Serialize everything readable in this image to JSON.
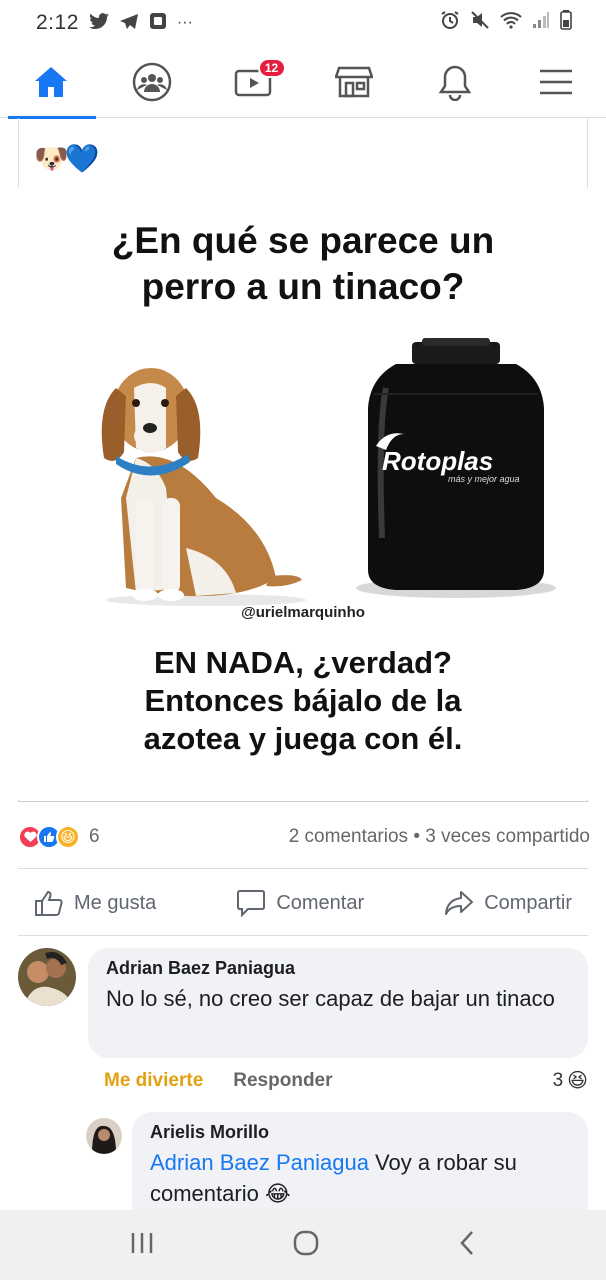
{
  "status_bar": {
    "time": "2:12",
    "more": "···"
  },
  "nav": {
    "video_badge": "12"
  },
  "post": {
    "emojis": "🐶💙",
    "meme": {
      "question_line1": "¿En qué se parece un",
      "question_line2": "perro a un tinaco?",
      "tank_brand": "Rotoplas",
      "tank_tagline": "más y mejor agua",
      "credit": "@urielmarquinho",
      "answer_line1": "EN NADA, ¿verdad?",
      "answer_line2": "Entonces bájalo de la",
      "answer_line3": "azotea y juega con él."
    },
    "reaction_count": "6",
    "comments_shares": "2 comentarios • 3 veces compartido",
    "actions": {
      "like": "Me gusta",
      "comment": "Comentar",
      "share": "Compartir"
    }
  },
  "comments": [
    {
      "author": "Adrian Baez Paniagua",
      "text": "No lo sé, no creo ser capaz de bajar un tinaco",
      "reaction_label": "Me divierte",
      "reply_label": "Responder",
      "reaction_count": "3"
    }
  ],
  "reply": {
    "author": "Arielis Morillo",
    "mention": "Adrian Baez Paniagua",
    "text": " Voy a robar su comentario 😂"
  },
  "colors": {
    "accent": "#1877f2",
    "badge": "#e41e3f",
    "haha": "#e2a112"
  }
}
